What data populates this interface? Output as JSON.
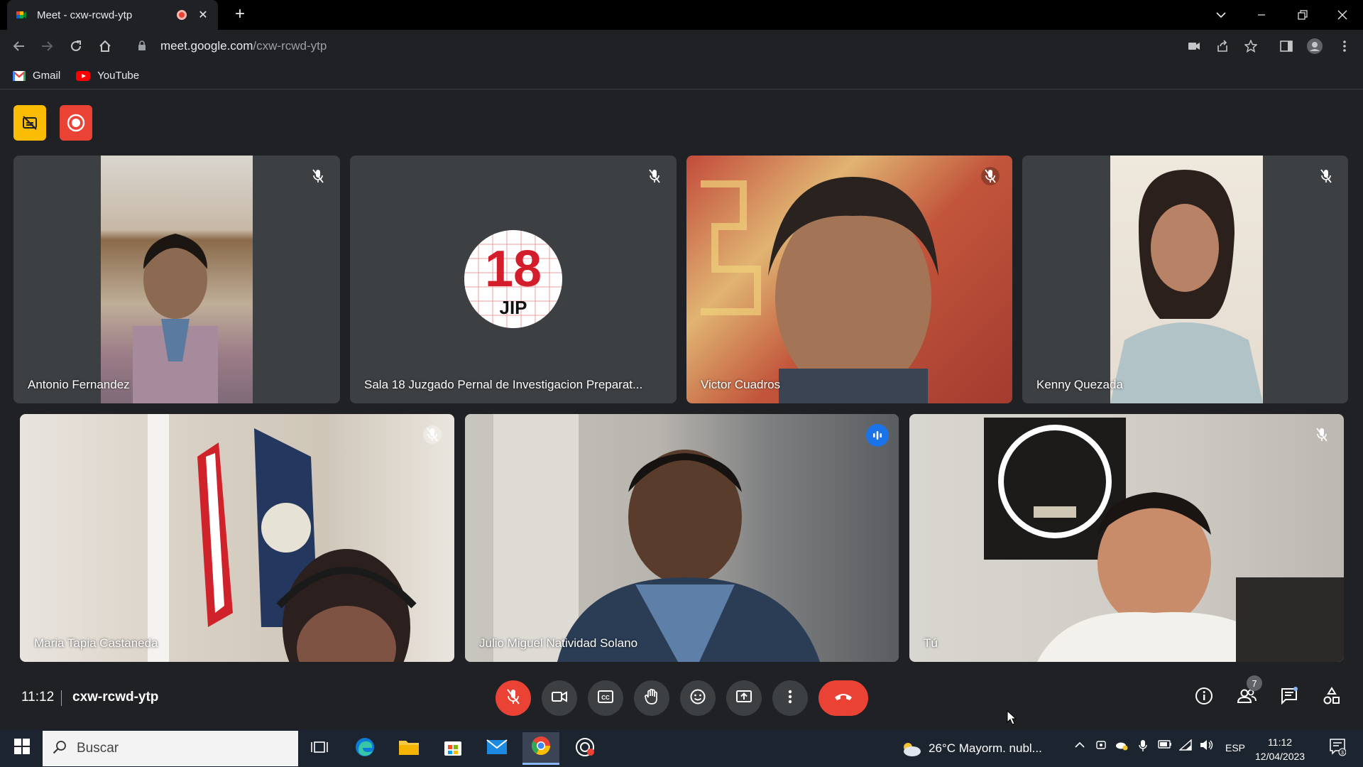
{
  "browser": {
    "tab_title": "Meet - cxw-rcwd-ytp",
    "tab_close": "✕",
    "new_tab": "+",
    "url_host": "meet.google.com",
    "url_path": "/cxw-rcwd-ytp",
    "bookmarks": [
      {
        "label": "Gmail",
        "icon": "gmail-icon"
      },
      {
        "label": "YouTube",
        "icon": "youtube-icon"
      }
    ]
  },
  "meet": {
    "top_badges": [
      {
        "icon": "no-captions-icon",
        "color": "#fbbc04"
      },
      {
        "icon": "recording-icon",
        "color": "#ea4335"
      }
    ],
    "participants": [
      {
        "name": "Antonio Fernandez",
        "muted": true
      },
      {
        "name": "Sala 18 Juzgado Pernal de Investigacion Preparat...",
        "muted": true,
        "avatar_line1": "18",
        "avatar_line2": "JIP"
      },
      {
        "name": "Victor Cuadros",
        "muted": true
      },
      {
        "name": "Kenny Quezada",
        "muted": true
      },
      {
        "name": "Maria Tapia Castaneda",
        "muted": true
      },
      {
        "name": "Julio Miguel Natividad Solano",
        "speaking": true
      },
      {
        "name": "Tú",
        "muted": true
      }
    ],
    "clock": "11:12",
    "meeting_code": "cxw-rcwd-ytp",
    "participants_count": "7"
  },
  "taskbar": {
    "search_placeholder": "Buscar",
    "weather": "26°C  Mayorm. nubl...",
    "language": "ESP",
    "time": "11:12",
    "date": "12/04/2023"
  },
  "colors": {
    "accent": "#8ab4f8",
    "end_call": "#ea4335",
    "speaking": "#1a73e8"
  }
}
